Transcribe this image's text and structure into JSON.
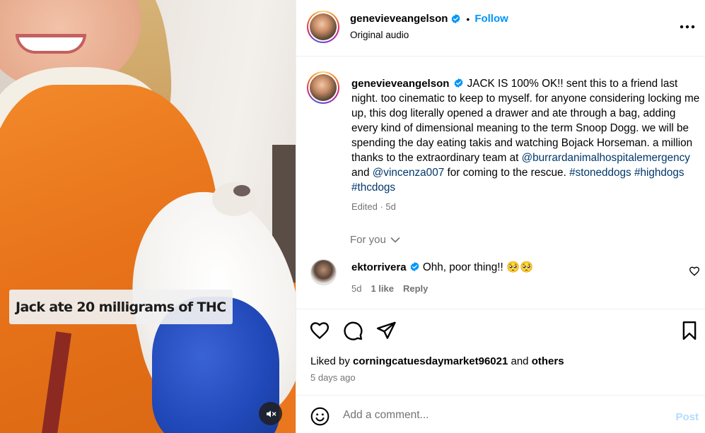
{
  "media": {
    "overlay_text": "Jack ate 20 milligrams of THC",
    "mute_icon": "speaker-muted-icon"
  },
  "header": {
    "username": "genevieveangelson",
    "separator": "•",
    "follow_label": "Follow",
    "audio_label": "Original audio",
    "more_icon": "more-horizontal-icon"
  },
  "caption": {
    "username": "genevieveangelson",
    "text_part1": "JACK IS 100% OK!! sent this to a friend last night. too cinematic to keep to myself. for anyone considering locking me up, this dog literally opened a drawer and ate through a bag, adding every kind of dimensional meaning to the term Snoop Dogg. we will be spending the day eating takis and watching Bojack Horseman. a million thanks to the extraordinary team at ",
    "mention1": "@burrardanimalhospitalemergency",
    "and": " and ",
    "mention2": "@vincenza007",
    "text_part2": " for coming to the rescue. ",
    "hashtags": [
      "#stoneddogs",
      "#highdogs",
      "#thcdogs"
    ],
    "meta": "Edited · 5d"
  },
  "for_you": {
    "label": "For you"
  },
  "comment": {
    "username": "ektorrivera",
    "text": "Ohh, poor thing!! 🥺🥺",
    "age": "5d",
    "likes": "1 like",
    "reply_label": "Reply"
  },
  "likes": {
    "prefix": "Liked by ",
    "user": "corningcatuesdaymarket96021",
    "middle": " and ",
    "others": "others",
    "time_ago": "5 days ago"
  },
  "comment_bar": {
    "placeholder": "Add a comment...",
    "post_label": "Post"
  },
  "colors": {
    "accent": "#0095f6",
    "link": "#00376b",
    "muted": "#737373",
    "post_disabled": "#b3dbff"
  }
}
